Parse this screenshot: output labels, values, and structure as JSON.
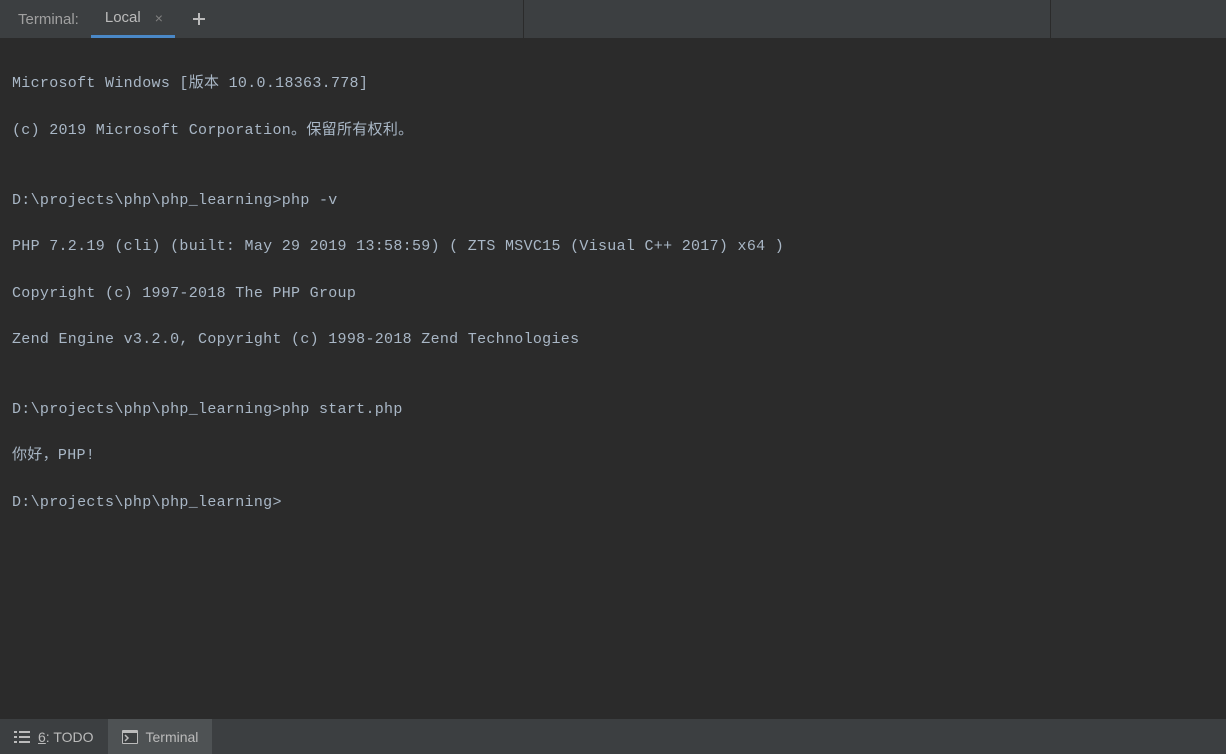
{
  "topBar": {
    "panelLabel": "Terminal:",
    "tabs": [
      {
        "label": "Local",
        "active": true
      }
    ]
  },
  "terminal": {
    "lines": [
      "Microsoft Windows [版本 10.0.18363.778]",
      "(c) 2019 Microsoft Corporation。保留所有权利。",
      "",
      "D:\\projects\\php\\php_learning>php -v",
      "PHP 7.2.19 (cli) (built: May 29 2019 13:58:59) ( ZTS MSVC15 (Visual C++ 2017) x64 )",
      "Copyright (c) 1997-2018 The PHP Group",
      "Zend Engine v3.2.0, Copyright (c) 1998-2018 Zend Technologies",
      "",
      "D:\\projects\\php\\php_learning>php start.php",
      "你好，PHP!",
      "D:\\projects\\php\\php_learning>"
    ]
  },
  "bottomBar": {
    "todo": {
      "prefix": "6",
      "label": ": TODO"
    },
    "terminal": {
      "label": "Terminal"
    }
  }
}
